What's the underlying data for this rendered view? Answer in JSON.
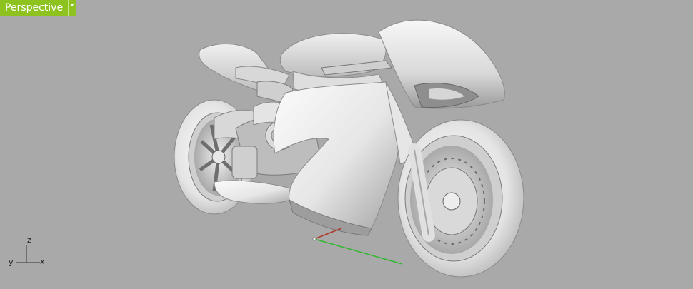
{
  "viewport": {
    "name": "Perspective"
  },
  "axis_widget": {
    "z_label": "z",
    "y_label": "y",
    "x_label": "x"
  },
  "colors": {
    "tab_background": "#8dc21f",
    "viewport_background": "#a9a9a9",
    "world_x_axis": "#b0392c",
    "world_y_axis": "#2fb82f"
  },
  "icons": {
    "viewport_menu": "triangle-down-icon"
  }
}
